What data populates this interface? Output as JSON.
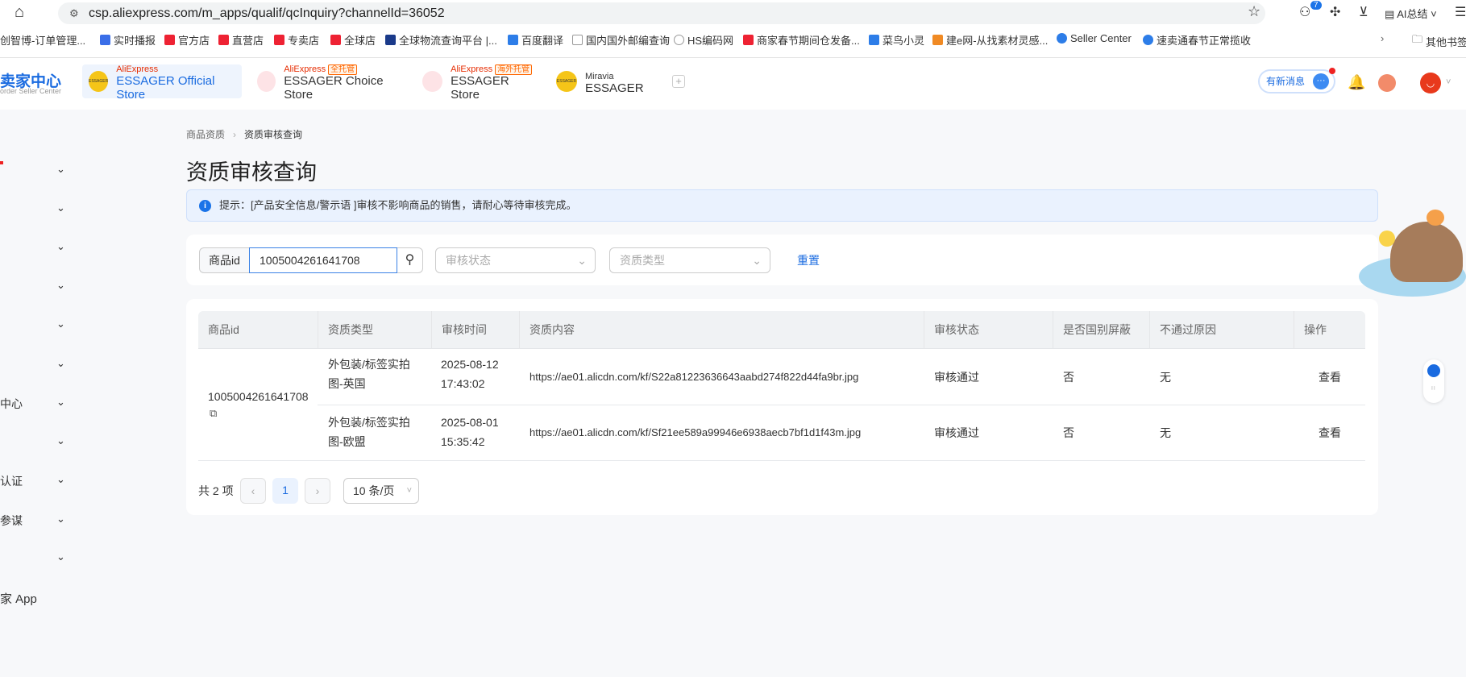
{
  "browser": {
    "url": "csp.aliexpress.com/m_apps/qualif/qcInquiry?channelId=36052",
    "ext_badge": "7",
    "ai_label": "AI总结",
    "bookmarks": [
      "创智博-订单管理...",
      "实时播报",
      "官方店",
      "直营店",
      "专卖店",
      "全球店",
      "全球物流查询平台 |...",
      "百度翻译",
      "国内国外邮编查询",
      "HS编码网",
      "商家春节期间仓发备...",
      "菜鸟小灵",
      "建e网-从找素材灵感...",
      "Seller Center",
      "速卖通春节正常揽收"
    ],
    "other_bookmarks": "其他书签"
  },
  "header": {
    "logo_title": "卖家中心",
    "logo_sub": "order Seller Center",
    "stores": [
      {
        "brand": "AliExpress",
        "tag": "",
        "name": "ESSAGER Official Store"
      },
      {
        "brand": "AliExpress",
        "tag": "全托管",
        "name": "ESSAGER Choice Store"
      },
      {
        "brand": "AliExpress",
        "tag": "海外托管",
        "name": "ESSAGER Store"
      },
      {
        "brand": "Miravia",
        "tag": "",
        "name": "ESSAGER"
      }
    ],
    "new_message": "有新消息"
  },
  "sidebar": {
    "items": [
      "",
      "",
      "",
      "",
      "",
      "",
      "中心",
      "",
      "认证",
      "参谋",
      ""
    ],
    "app": "家 App"
  },
  "breadcrumb": [
    "商品资质",
    "资质审核查询"
  ],
  "page_title": "资质审核查询",
  "alert": "提示：[产品安全信息/警示语 ]审核不影响商品的销售，请耐心等待审核完成。",
  "filters": {
    "id_label": "商品id",
    "id_value": "1005004261641708",
    "status_placeholder": "审核状态",
    "type_placeholder": "资质类型",
    "reset": "重置"
  },
  "table": {
    "headers": [
      "商品id",
      "资质类型",
      "审核时间",
      "资质内容",
      "审核状态",
      "是否国别屏蔽",
      "不通过原因",
      "操作"
    ],
    "product_id": "1005004261641708",
    "rows": [
      {
        "type": "外包装/标签实拍图-英国",
        "time": "2025-08-12 17:43:02",
        "content": "https://ae01.alicdn.com/kf/S22a81223636643aabd274f822d44fa9br.jpg",
        "status": "审核通过",
        "blocked": "否",
        "reason": "无",
        "action": "查看"
      },
      {
        "type": "外包装/标签实拍图-欧盟",
        "time": "2025-08-01 15:35:42",
        "content": "https://ae01.alicdn.com/kf/Sf21ee589a99946e6938aecb7bf1d1f43m.jpg",
        "status": "审核通过",
        "blocked": "否",
        "reason": "无",
        "action": "查看"
      }
    ]
  },
  "pagination": {
    "total": "共 2 项",
    "current": "1",
    "page_size": "10 条/页"
  }
}
